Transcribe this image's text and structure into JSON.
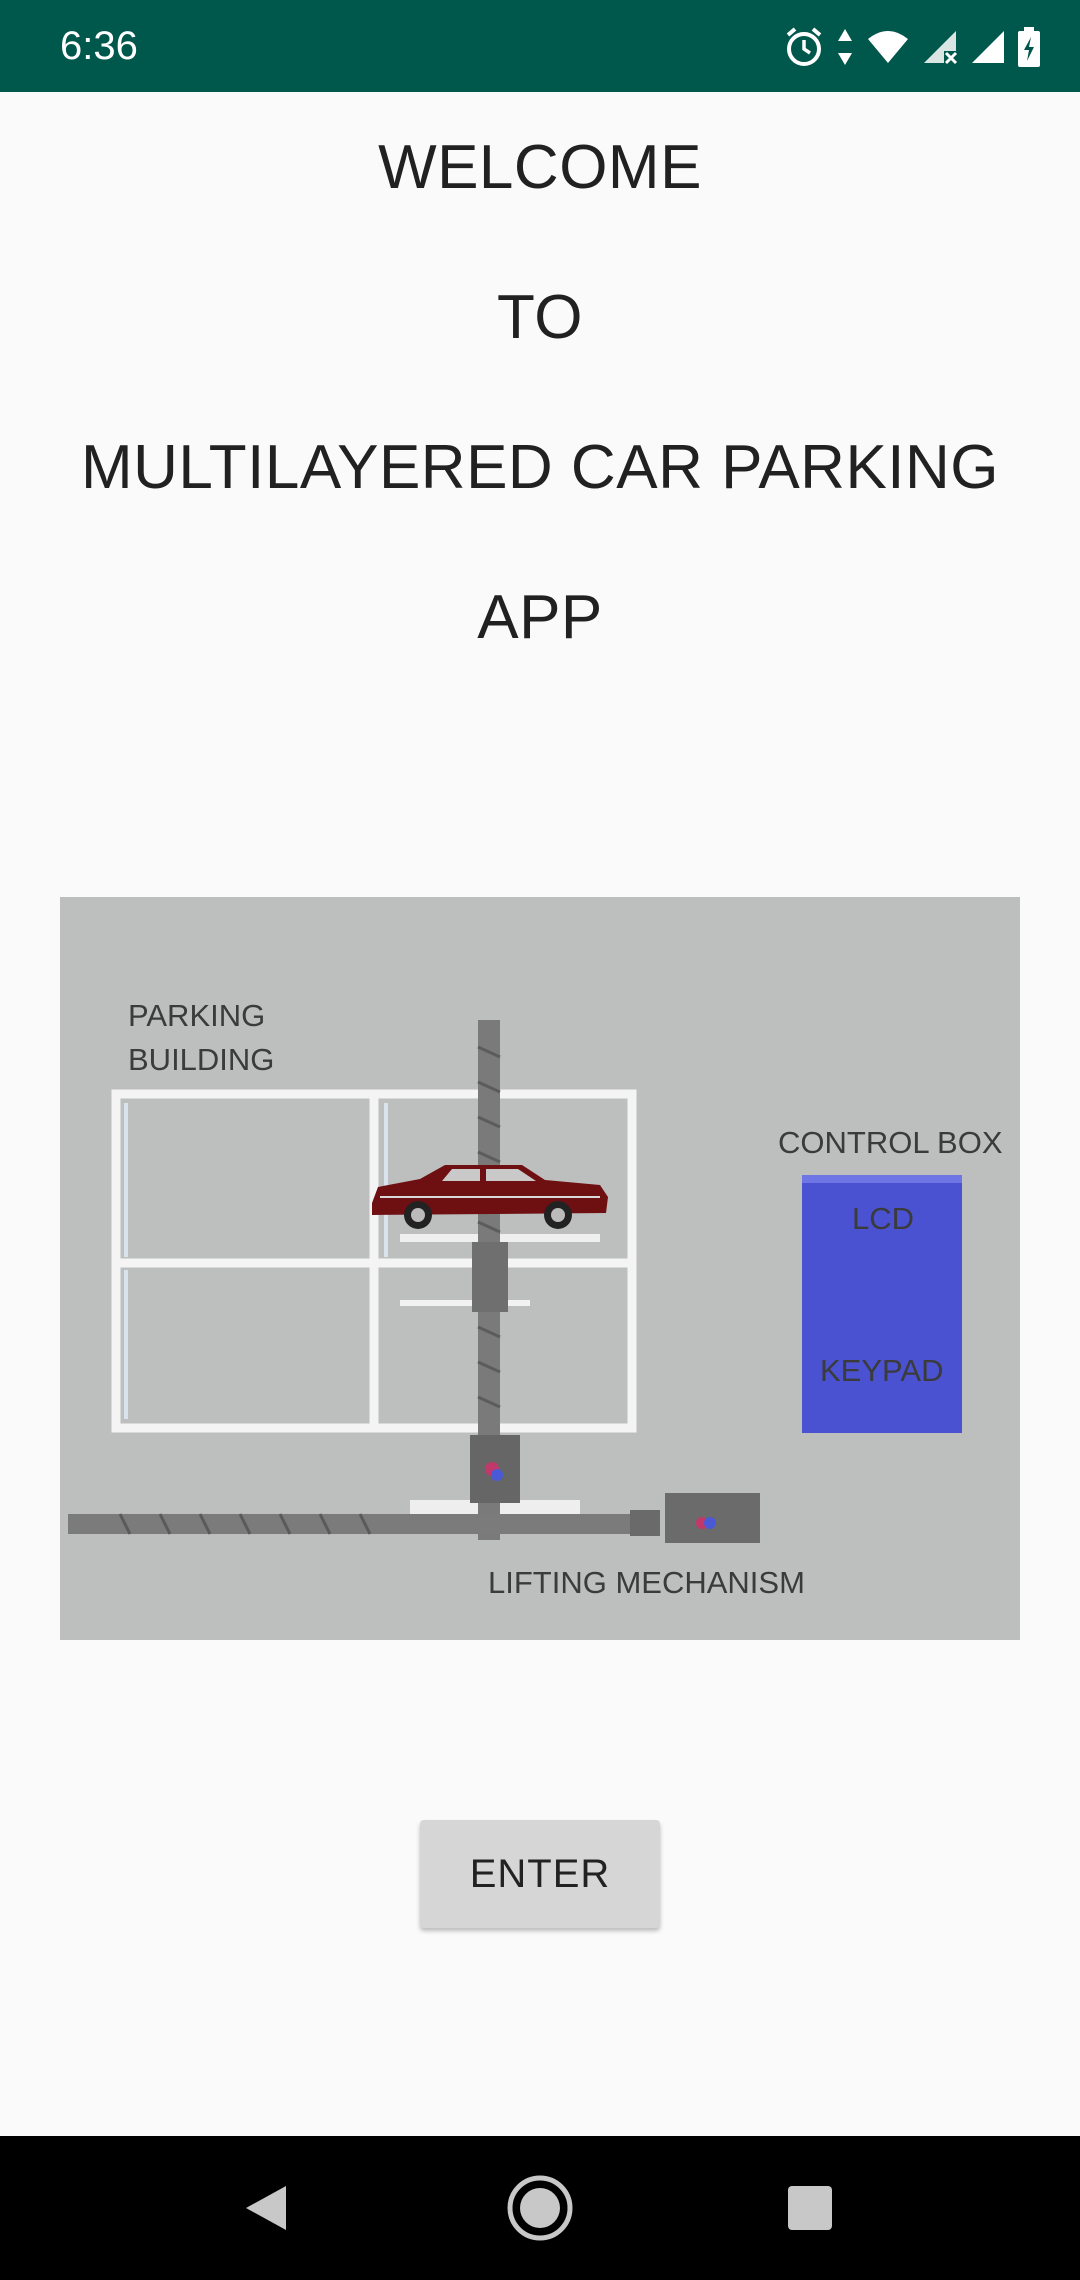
{
  "status_bar": {
    "time": "6:36",
    "icons": [
      "alarm-icon",
      "data-arrows-icon",
      "wifi-icon",
      "signal-x-icon",
      "signal-icon",
      "battery-charging-icon"
    ],
    "background": "#00574b"
  },
  "title_lines": [
    "WELCOME",
    "TO",
    "MULTILAYERED CAR PARKING",
    "APP"
  ],
  "diagram": {
    "labels": {
      "parking_building": "PARKING\nBUILDING",
      "control_box": "CONTROL BOX",
      "lcd": "LCD",
      "keypad": "KEYPAD",
      "lifting_mechanism": "LIFTING MECHANISM"
    },
    "colors": {
      "background": "#bdbebe",
      "control_box": "#4a52d1",
      "car": "#6e0f12"
    }
  },
  "enter_button": {
    "label": "ENTER"
  },
  "nav_bar": {
    "icons": [
      "back-icon",
      "home-icon",
      "recents-icon"
    ]
  }
}
